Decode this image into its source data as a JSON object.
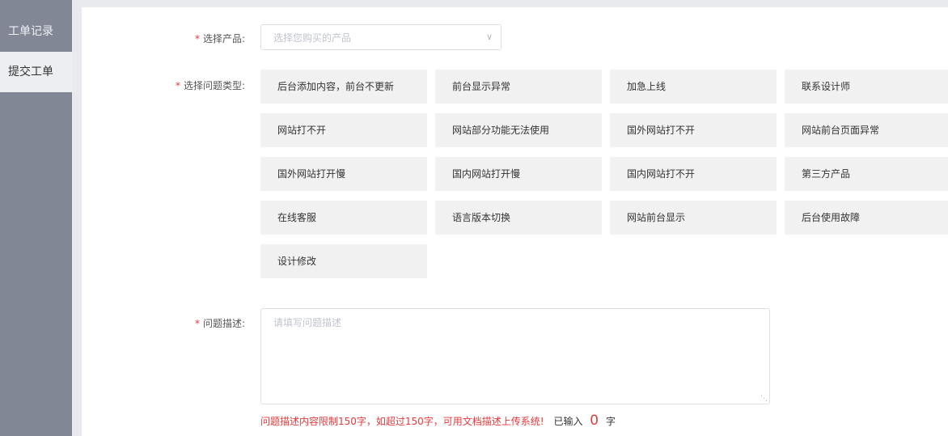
{
  "sidebar": {
    "items": [
      {
        "label": "工单记录",
        "active": false
      },
      {
        "label": "提交工单",
        "active": true
      }
    ]
  },
  "form": {
    "product": {
      "required_mark": "*",
      "label": "选择产品:",
      "placeholder": "选择您购买的产品",
      "icon": "chevron-down-icon"
    },
    "issue_type": {
      "required_mark": "*",
      "label": "选择问题类型:",
      "options": [
        "后台添加内容，前台不更新",
        "前台显示异常",
        "加急上线",
        "联系设计师",
        "网站打不开",
        "网站部分功能无法使用",
        "国外网站打不开",
        "网站前台页面异常",
        "国外网站打开慢",
        "国内网站打开慢",
        "国内网站打不开",
        "第三方产品",
        "在线客服",
        "语言版本切换",
        "网站前台显示",
        "后台使用故障",
        "设计修改"
      ]
    },
    "description": {
      "required_mark": "*",
      "label": "问题描述:",
      "placeholder": "请填写问题描述",
      "limit_hint": "问题描述内容限制150字，如超过150字，可用文档描述上传系统!",
      "typed_label": "已输入",
      "typed_count": "0",
      "typed_unit": "字"
    }
  },
  "colors": {
    "sidebar_bg": "#828795",
    "required": "#e4393c",
    "option_bg": "#f1f1f1"
  }
}
